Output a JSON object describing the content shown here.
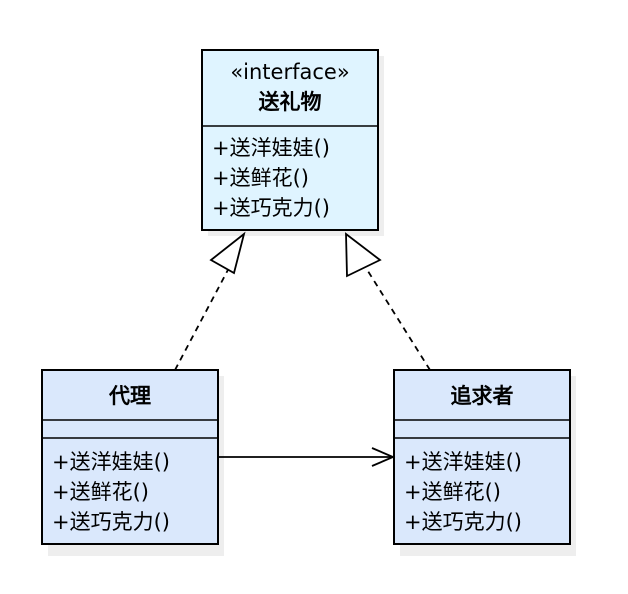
{
  "interface": {
    "stereotype": "«interface»",
    "name": "送礼物",
    "methods": [
      "+送洋娃娃()",
      "+送鲜花()",
      "+送巧克力()"
    ],
    "fill": "#dff4ff"
  },
  "proxy": {
    "name": "代理",
    "methods": [
      "+送洋娃娃()",
      "+送鲜花()",
      "+送巧克力()"
    ],
    "fill": "#dae8fc"
  },
  "pursuer": {
    "name": "追求者",
    "methods": [
      "+送洋娃娃()",
      "+送鲜花()",
      "+送巧克力()"
    ],
    "fill": "#dae8fc"
  },
  "colors": {
    "stroke": "#000000",
    "shadow": "#eeeeee"
  }
}
